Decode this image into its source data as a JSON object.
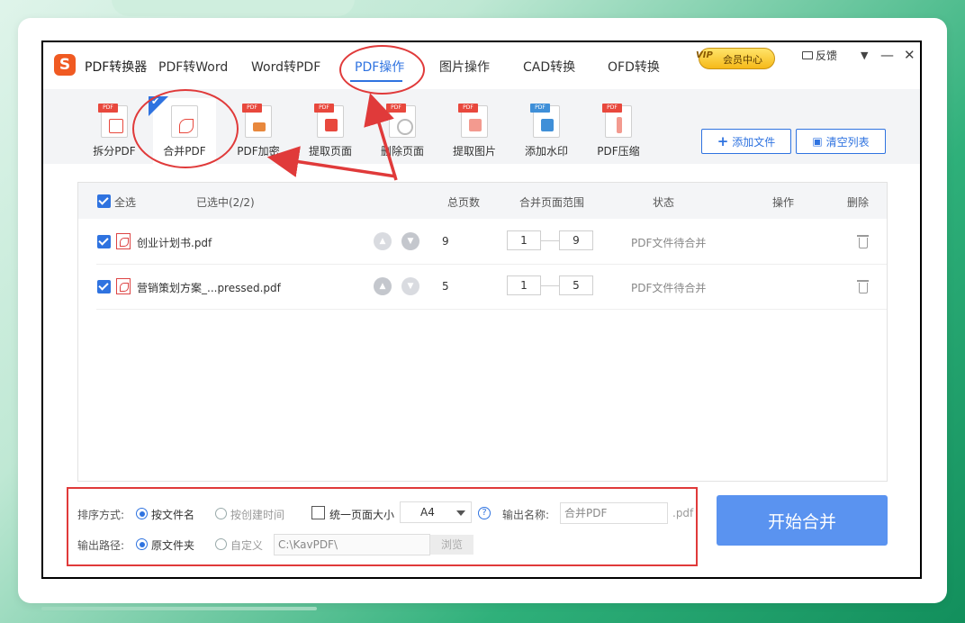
{
  "app": {
    "title": "PDF转换器",
    "nav": [
      "PDF转Word",
      "Word转PDF",
      "PDF操作",
      "图片操作",
      "CAD转换",
      "OFD转换"
    ],
    "active_nav": "PDF操作",
    "vip_badge": "VIP",
    "vip_label": "会员中心",
    "feedback": "反馈",
    "menu_icon": "▼",
    "minimize_icon": "—",
    "close_icon": "✕"
  },
  "toolbar": {
    "tools": [
      {
        "label": "拆分PDF",
        "icon": "split-pdf-icon",
        "color": "#e8483d"
      },
      {
        "label": "合并PDF",
        "icon": "merge-pdf-icon",
        "color": "#e8483d"
      },
      {
        "label": "PDF加密",
        "icon": "lock-pdf-icon",
        "color": "#e8883d"
      },
      {
        "label": "提取页面",
        "icon": "extract-page-icon",
        "color": "#e8483d"
      },
      {
        "label": "删除页面",
        "icon": "delete-page-icon",
        "color": "#aaaaaa"
      },
      {
        "label": "提取图片",
        "icon": "extract-image-icon",
        "color": "#e8483d"
      },
      {
        "label": "添加水印",
        "icon": "watermark-icon",
        "color": "#3f8fd8"
      },
      {
        "label": "PDF压缩",
        "icon": "compress-pdf-icon",
        "color": "#e8483d"
      }
    ],
    "add_file": "添加文件",
    "clear_list": "清空列表"
  },
  "list": {
    "headers": {
      "select_all": "全选",
      "selected": "已选中(2/2)",
      "total_pages": "总页数",
      "range": "合并页面范围",
      "status": "状态",
      "action": "操作",
      "delete": "删除"
    },
    "rows": [
      {
        "name": "创业计划书.pdf",
        "pages": "9",
        "from": "1",
        "to": "9",
        "status": "PDF文件待合并"
      },
      {
        "name": "营销策划方案_...pressed.pdf",
        "pages": "5",
        "from": "1",
        "to": "5",
        "status": "PDF文件待合并"
      }
    ]
  },
  "options": {
    "sort_label": "排序方式:",
    "sort_by_name": "按文件名",
    "sort_by_time": "按创建时间",
    "unify_size": "统一页面大小",
    "page_size": "A4",
    "help": "?",
    "output_name_label": "输出名称:",
    "output_name_placeholder": "合并PDF",
    "ext": ".pdf",
    "output_path_label": "输出路径:",
    "path_original": "原文件夹",
    "path_custom": "自定义",
    "path_value": "C:\\KavPDF\\",
    "browse": "浏览",
    "start": "开始合并"
  },
  "colors": {
    "accent": "#2f73e0",
    "start_button": "#5a93f0",
    "annotation": "#e03a3a"
  }
}
